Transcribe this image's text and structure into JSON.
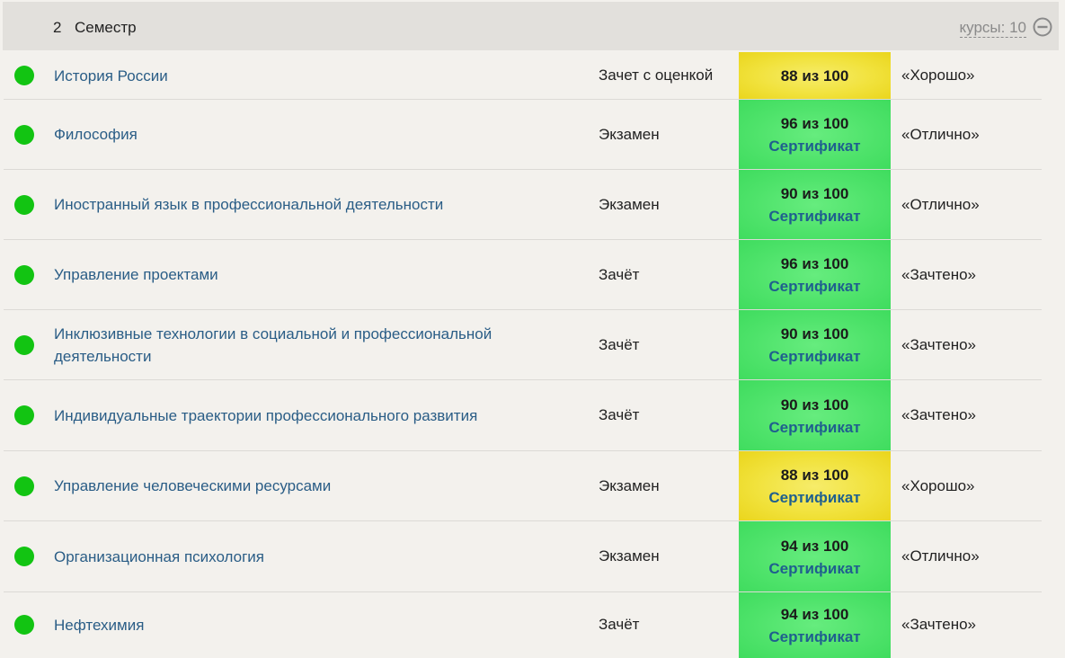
{
  "semester": {
    "number": "2",
    "label": "Семестр",
    "courses_count": "курсы: 10"
  },
  "courses": [
    {
      "name": "История России",
      "control": "Зачет с оценкой",
      "score": "88 из 100",
      "certificate": "",
      "grade": "«Хорошо»",
      "score_color": "#f1e23c"
    },
    {
      "name": "Философия",
      "control": "Экзамен",
      "score": "96 из 100",
      "certificate": "Сертификат",
      "grade": "«Отлично»",
      "score_color": "#4fe36b"
    },
    {
      "name": "Иностранный язык в профессиональной деятельности",
      "control": "Экзамен",
      "score": "90 из 100",
      "certificate": "Сертификат",
      "grade": "«Отлично»",
      "score_color": "#4fe36b"
    },
    {
      "name": "Управление проектами",
      "control": "Зачёт",
      "score": "96 из 100",
      "certificate": "Сертификат",
      "grade": "«Зачтено»",
      "score_color": "#4fe36b"
    },
    {
      "name": "Инклюзивные технологии в социальной и профессиональной деятельности",
      "control": "Зачёт",
      "score": "90 из 100",
      "certificate": "Сертификат",
      "grade": "«Зачтено»",
      "score_color": "#4fe36b"
    },
    {
      "name": "Индивидуальные траектории профессионального развития",
      "control": "Зачёт",
      "score": "90 из 100",
      "certificate": "Сертификат",
      "grade": "«Зачтено»",
      "score_color": "#4fe36b"
    },
    {
      "name": "Управление человеческими ресурсами",
      "control": "Экзамен",
      "score": "88 из 100",
      "certificate": "Сертификат",
      "grade": "«Хорошо»",
      "score_color": "#f1e23c"
    },
    {
      "name": "Организационная психология",
      "control": "Экзамен",
      "score": "94 из 100",
      "certificate": "Сертификат",
      "grade": "«Отлично»",
      "score_color": "#4fe36b"
    },
    {
      "name": "Нефтехимия",
      "control": "Зачёт",
      "score": "94 из 100",
      "certificate": "Сертификат",
      "grade": "«Зачтено»",
      "score_color": "#4fe36b"
    }
  ],
  "colors": {
    "status_ok": "#12c412",
    "link": "#2a5d86",
    "header_bg": "#e2e0dc",
    "page_bg": "#f3f1ed"
  },
  "icons": {
    "collapse": "minus-circle-icon",
    "status": "green-dot-icon"
  }
}
